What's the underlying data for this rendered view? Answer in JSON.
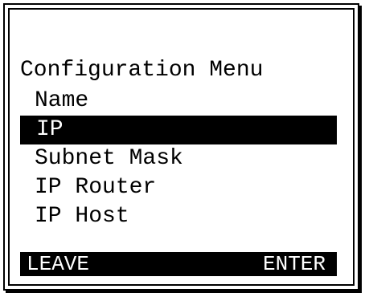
{
  "screen": {
    "title": "Configuration Menu",
    "menu_items": [
      {
        "label": "Name"
      },
      {
        "label": "IP",
        "selected": true
      },
      {
        "label": "Subnet Mask"
      },
      {
        "label": "IP Router"
      },
      {
        "label": "IP Host"
      }
    ]
  },
  "softkeys": {
    "left": "LEAVE",
    "right": "ENTER"
  },
  "colors": {
    "background": "#ffffff",
    "foreground": "#000000",
    "highlight_background": "#000000",
    "highlight_text": "#ffffff"
  }
}
